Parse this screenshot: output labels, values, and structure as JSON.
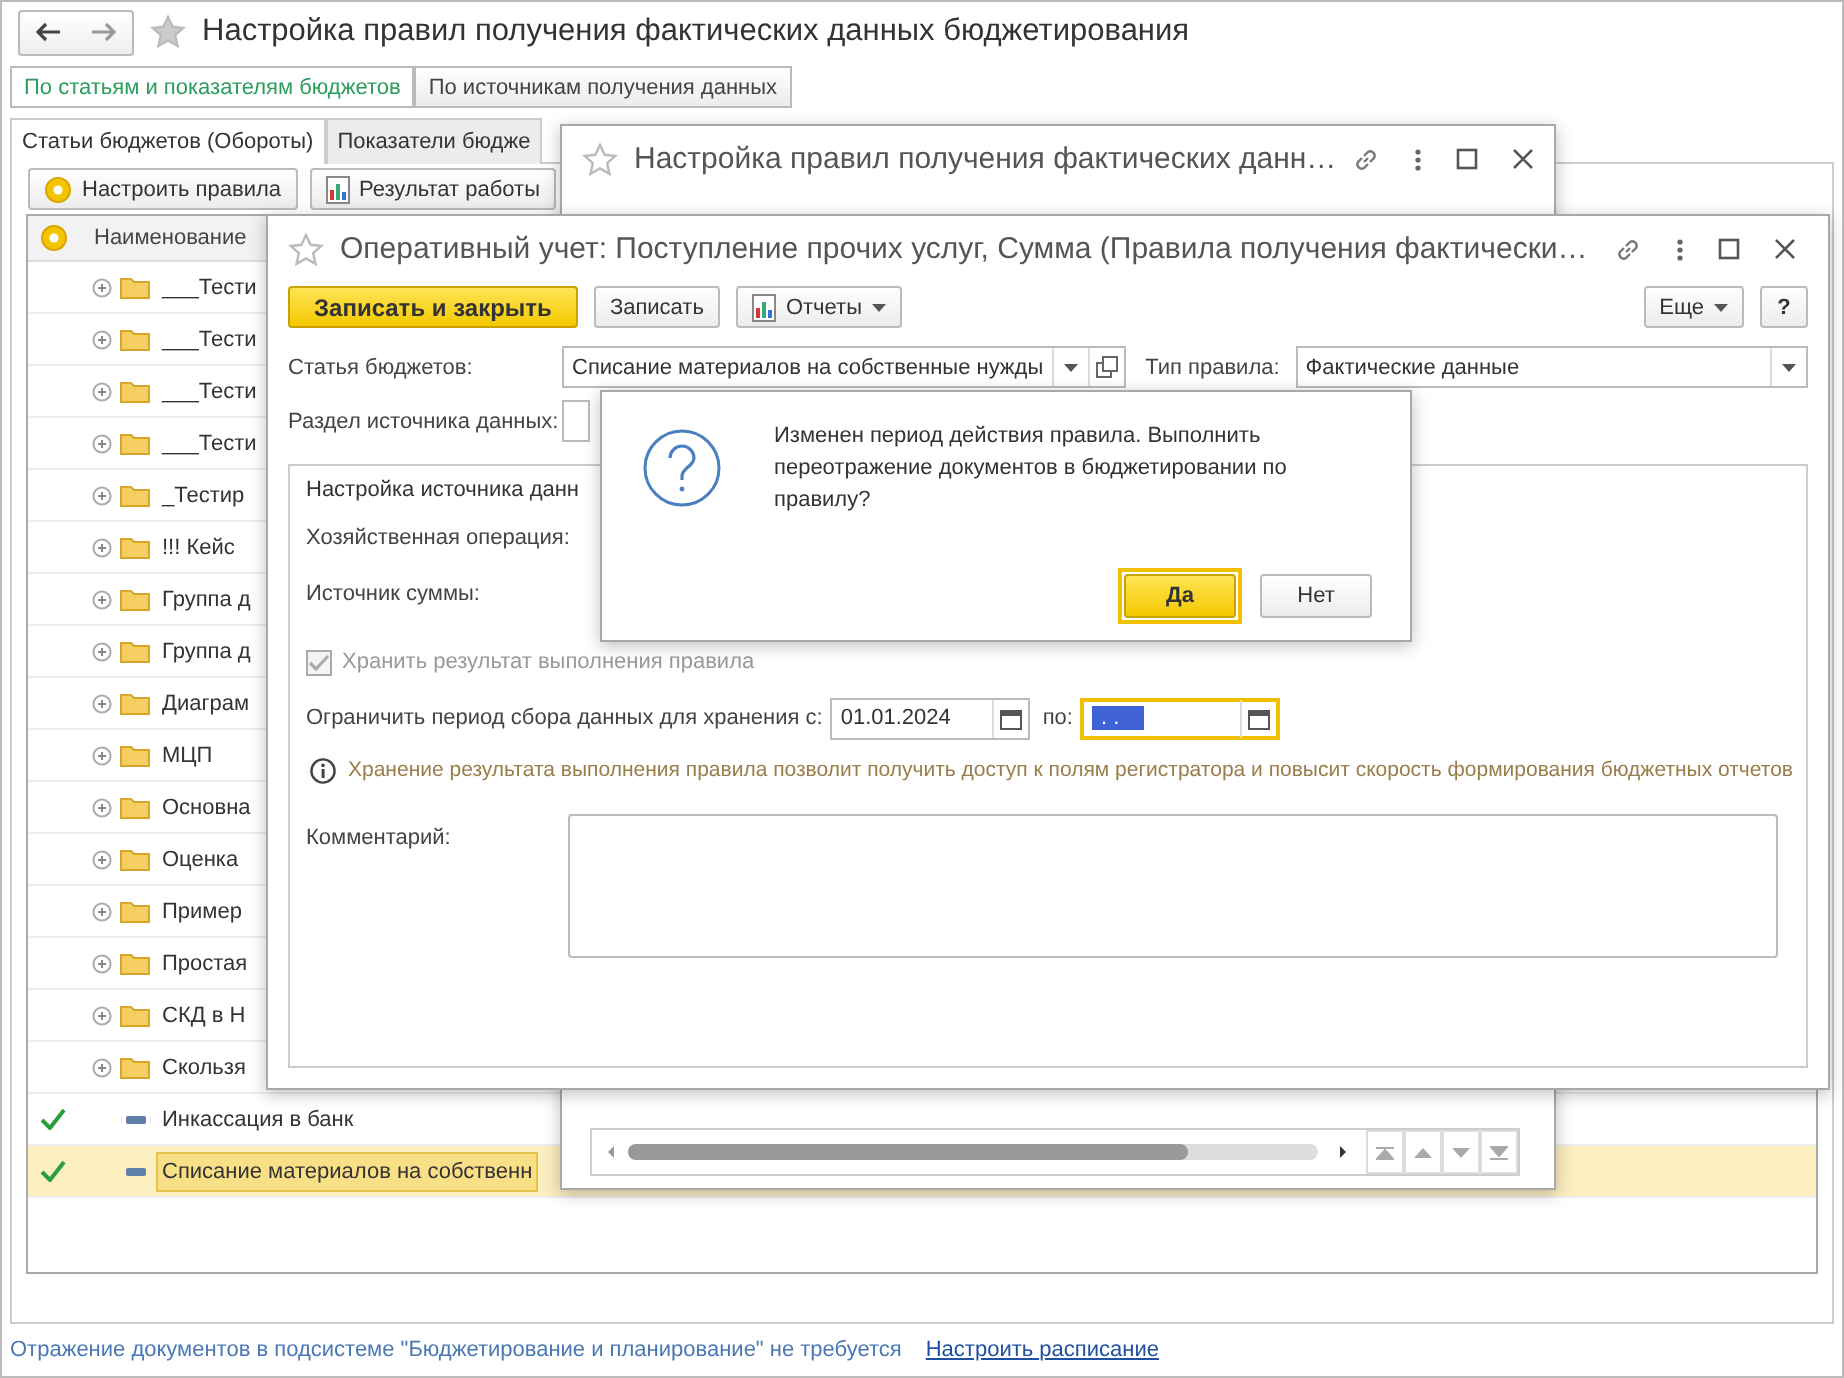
{
  "main_window": {
    "title": "Настройка правил получения фактических данных бюджетирования",
    "view_switch": [
      {
        "label": "По статьям и показателям бюджетов",
        "selected": true
      },
      {
        "label": "По источникам получения данных",
        "selected": false
      }
    ],
    "tabs": [
      {
        "label": "Статьи бюджетов (Обороты)",
        "selected": true
      },
      {
        "label": "Показатели бюдже",
        "selected": false
      }
    ],
    "toolbar": [
      "Настроить правила",
      "Результат работы"
    ],
    "table": {
      "columns": [
        "Наименование"
      ],
      "rows": [
        {
          "name": "___Тести",
          "kind": "group",
          "configured": false,
          "selected": false
        },
        {
          "name": "___Тести",
          "kind": "group",
          "configured": false,
          "selected": false
        },
        {
          "name": "___Тести",
          "kind": "group",
          "configured": false,
          "selected": false
        },
        {
          "name": "___Тести",
          "kind": "group",
          "configured": false,
          "selected": false
        },
        {
          "name": "_Тестир",
          "kind": "group",
          "configured": false,
          "selected": false
        },
        {
          "name": "!!! Кейс",
          "kind": "group",
          "configured": false,
          "selected": false
        },
        {
          "name": "Группа д",
          "kind": "group",
          "configured": false,
          "selected": false
        },
        {
          "name": "Группа д",
          "kind": "group",
          "configured": false,
          "selected": false
        },
        {
          "name": "Диаграм",
          "kind": "group",
          "configured": false,
          "selected": false
        },
        {
          "name": "МЦП",
          "kind": "group",
          "configured": false,
          "selected": false
        },
        {
          "name": "Основна",
          "kind": "group",
          "configured": false,
          "selected": false
        },
        {
          "name": "Оценка",
          "kind": "group",
          "configured": false,
          "selected": false
        },
        {
          "name": "Пример",
          "kind": "group",
          "configured": false,
          "selected": false
        },
        {
          "name": "Простая",
          "kind": "group",
          "configured": false,
          "selected": false
        },
        {
          "name": "СКД в Н",
          "kind": "group",
          "configured": false,
          "selected": false
        },
        {
          "name": "Скользя",
          "kind": "group",
          "configured": false,
          "selected": false
        },
        {
          "name": "Инкассация в банк",
          "kind": "item",
          "configured": true,
          "selected": false
        },
        {
          "name": "Списание материалов на собственн",
          "kind": "item",
          "configured": true,
          "selected": true
        }
      ]
    },
    "status_bar": {
      "text": "Отражение документов в подсистеме \"Бюджетирование и планирование\" не требуется",
      "link": "Настроить расписание"
    }
  },
  "rules_window": {
    "title": "Настройка правил получения фактических данн…"
  },
  "rule_window": {
    "title": "Оперативный учет: Поступление прочих услуг, Сумма (Правила получения фактически…",
    "buttons": [
      {
        "label": "Записать и закрыть",
        "kind": "primary"
      },
      {
        "label": "Записать",
        "kind": "plain"
      },
      {
        "label": "Отчеты",
        "kind": "menu"
      }
    ],
    "more_button": "Еще",
    "help_button": "?",
    "budget_item": {
      "label": "Статья бюджетов:",
      "value": "Списание материалов на собственные нужды"
    },
    "rule_type": {
      "label": "Тип правила:",
      "value": "Фактические данные"
    },
    "source_section": {
      "label": "Раздел источника данных:"
    },
    "source_group": {
      "title": "Настройка источника данн",
      "operation_label": "Хозяйственная операция:",
      "amount_source_label": "Источник суммы:",
      "store_result": {
        "label": "Хранить результат выполнения правила",
        "checked": true,
        "disabled": true
      },
      "limit_period": {
        "label": "Ограничить период сбора данных для хранения с:",
        "from": "01.01.2024",
        "to_label": "по:",
        "to": ". .",
        "to_selected": true,
        "to_focused": true
      },
      "info": "Хранение результата выполнения правила позволит получить доступ к полям регистратора и повысит скорость формирования бюджетных отчетов",
      "comment_label": "Комментарий:"
    }
  },
  "dialog": {
    "message": "Изменен период действия правила. Выполнить переотражение документов в бюджетировании по правилу?",
    "buttons": [
      {
        "label": "Да",
        "default": true
      },
      {
        "label": "Нет",
        "default": false
      }
    ]
  }
}
